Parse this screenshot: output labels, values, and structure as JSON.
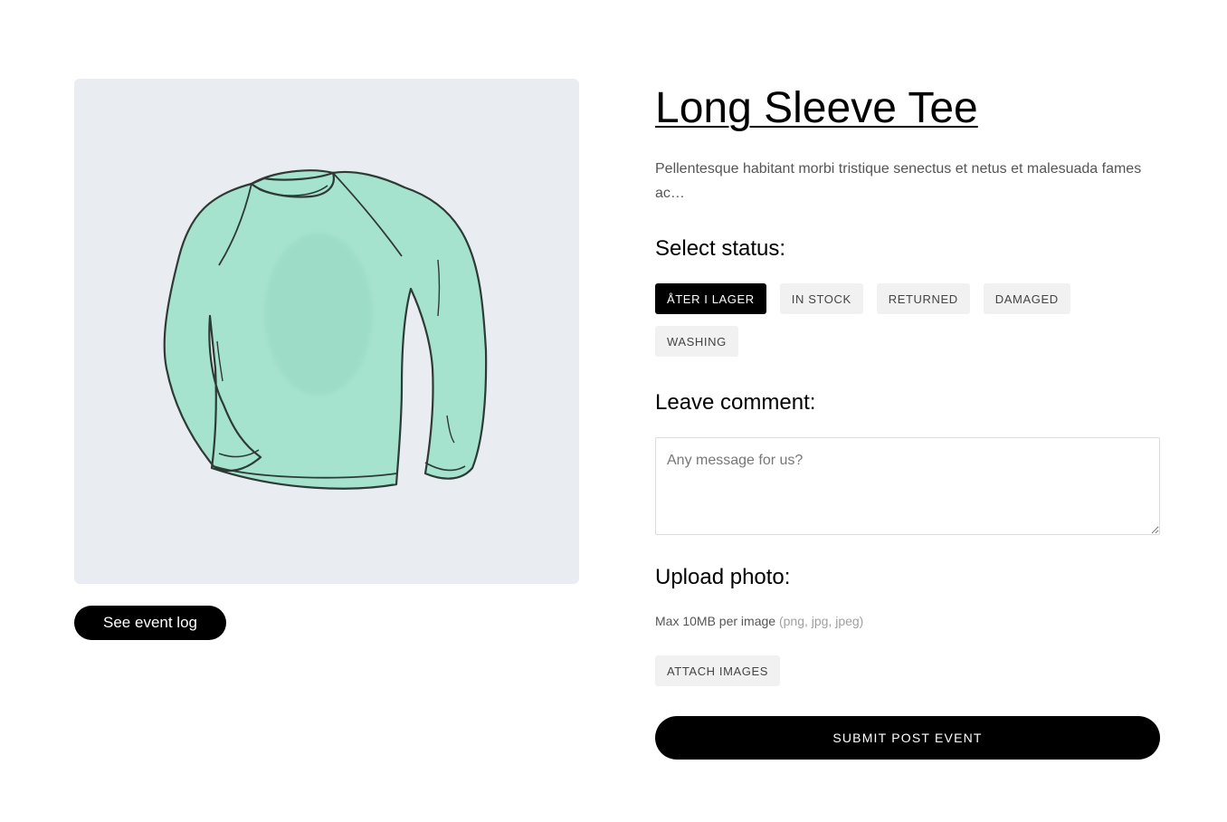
{
  "product": {
    "title": "Long Sleeve Tee",
    "description": "Pellentesque habitant morbi tristique senectus et netus et malesuada fames ac…",
    "image_icon": "long-sleeve-shirt-illustration",
    "image_color": "#9fe0c8"
  },
  "left": {
    "event_log_label": "See event log"
  },
  "status": {
    "label": "Select status:",
    "options": [
      "ÅTER I LAGER",
      "IN STOCK",
      "RETURNED",
      "DAMAGED",
      "WASHING"
    ],
    "selected": "ÅTER I LAGER"
  },
  "comment": {
    "label": "Leave comment:",
    "placeholder": "Any message for us?",
    "value": ""
  },
  "upload": {
    "label": "Upload photo:",
    "hint": "Max 10MB per image",
    "types": "(png, jpg, jpeg)",
    "attach_label": "ATTACH IMAGES"
  },
  "submit": {
    "label": "SUBMIT POST EVENT"
  },
  "colors": {
    "accent": "#000000",
    "chip_bg": "#f1f1f1",
    "image_bg": "#e9edf1"
  }
}
